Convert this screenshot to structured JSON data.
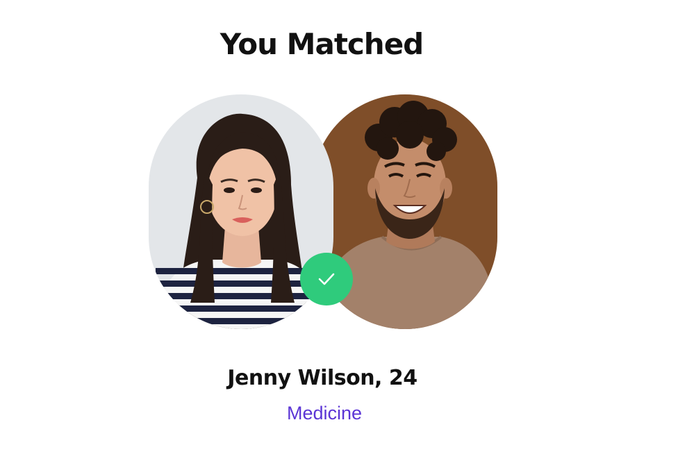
{
  "header": {
    "title": "You Matched"
  },
  "match": {
    "user_photo_icon": "woman-portrait-photo",
    "match_photo_icon": "man-portrait-photo",
    "badge_icon": "checkmark-icon",
    "name_age": "Jenny Wilson, 24",
    "field": "Medicine"
  },
  "colors": {
    "title": "#111111",
    "accent": "#5b35d5",
    "badge": "#2fcb7c",
    "left_photo_bg": "#e3e6e9",
    "right_photo_bg": "#7a4a26"
  }
}
